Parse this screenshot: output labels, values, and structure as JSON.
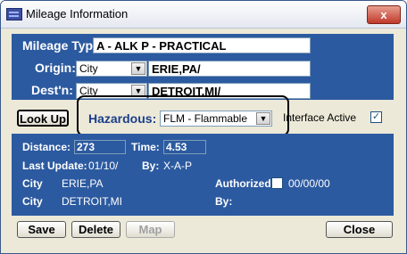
{
  "window": {
    "title": "Mileage Information",
    "close_symbol": "x"
  },
  "mileage": {
    "type_label": "Mileage Type:",
    "type_value": "A - ALK P - PRACTICAL",
    "origin_label": "Origin:",
    "origin_kind": "City",
    "origin_value": "ERIE,PA/",
    "dest_label": "Dest'n:",
    "dest_kind": "City",
    "dest_value": "DETROIT,MI/"
  },
  "actions": {
    "lookup_label": "Look Up",
    "hazardous_label": "Hazardous:",
    "hazardous_value": "FLM - Flammable",
    "interface_label": "Interface Active",
    "interface_checked": true
  },
  "details": {
    "distance_label": "Distance:",
    "distance_value": "273",
    "time_label": "Time:",
    "time_value": "4.53",
    "last_update_label": "Last Update:",
    "last_update_value": "01/10/",
    "by_label": "By:",
    "by_value": "X-A-P",
    "row1_label": "City",
    "row1_value": "ERIE,PA",
    "authorized_label": "Authorized",
    "authorized_date": "00/00/00",
    "row2_label": "City",
    "row2_value": "DETROIT,MI",
    "by2_label": "By:"
  },
  "footer": {
    "save_label": "Save",
    "delete_label": "Delete",
    "map_label": "Map",
    "close_label": "Close"
  }
}
